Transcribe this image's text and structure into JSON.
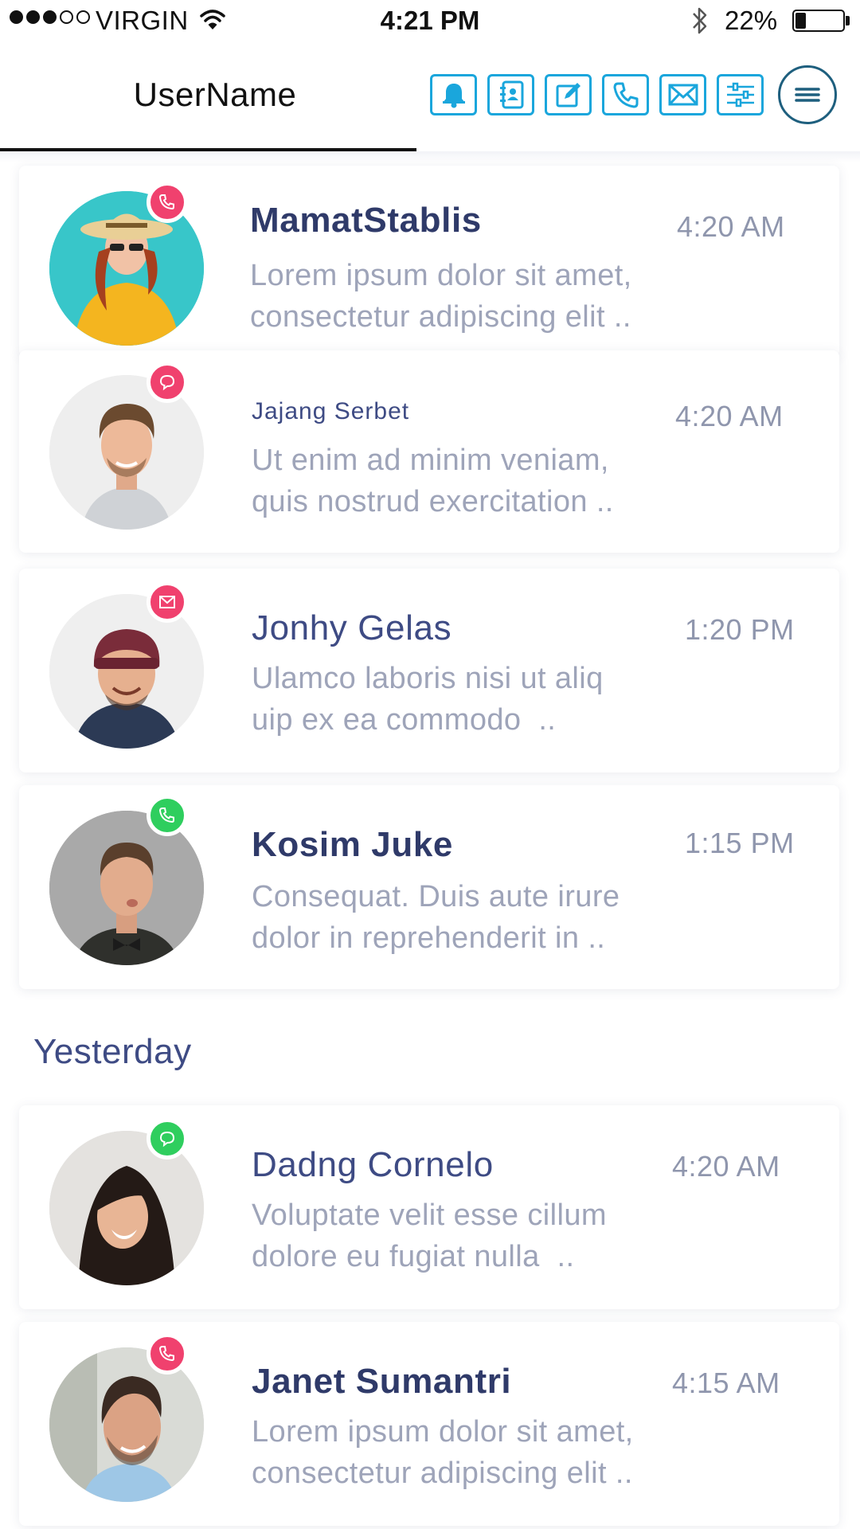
{
  "status_bar": {
    "carrier": "VIRGIN",
    "time": "4:21 PM",
    "battery": "22%",
    "battery_level": 0.22
  },
  "header": {
    "username": "UserName",
    "toolbar": [
      "bell-icon",
      "contacts-icon",
      "compose-icon",
      "phone-icon",
      "mail-icon",
      "settings-sliders-icon"
    ],
    "menu_icon": "hamburger-menu-icon"
  },
  "colors": {
    "accent": "#1aa6dc",
    "menu_ring": "#1e5f7e",
    "name_text": "#2f3a69",
    "preview_text": "#9ea4b9",
    "badge_pink": "#f0416e",
    "badge_green": "#2fce5e"
  },
  "sections": {
    "yesterday": "Yesterday"
  },
  "conversations": [
    {
      "name": "MamatStablis",
      "time": "4:20 AM",
      "preview_line1": "Lorem ipsum dolor sit amet,",
      "preview_line2": "consectetur adipiscing elit ..",
      "badge": "phone-icon",
      "badge_color": "pink"
    },
    {
      "name": "Jajang Serbet",
      "time": "4:20 AM",
      "preview_line1": "Ut enim ad minim veniam,",
      "preview_line2": "quis nostrud exercitation ..",
      "badge": "chat-bubble-icon",
      "badge_color": "pink"
    },
    {
      "name": "Jonhy Gelas",
      "time": "1:20 PM",
      "preview_line1": "Ulamco laboris nisi ut aliq",
      "preview_line2": "uip ex ea commodo  ..",
      "badge": "mail-icon",
      "badge_color": "pink"
    },
    {
      "name": "Kosim Juke",
      "time": "1:15 PM",
      "preview_line1": "Consequat. Duis aute irure",
      "preview_line2": "dolor in reprehenderit in ..",
      "badge": "phone-icon",
      "badge_color": "green"
    },
    {
      "name": "Dadng Cornelo",
      "time": "4:20 AM",
      "preview_line1": "Voluptate velit esse cillum",
      "preview_line2": "dolore eu fugiat nulla  ..",
      "badge": "chat-bubble-icon",
      "badge_color": "green"
    },
    {
      "name": "Janet Sumantri",
      "time": "4:15 AM",
      "preview_line1": "Lorem ipsum dolor sit amet,",
      "preview_line2": "consectetur adipiscing elit ..",
      "badge": "phone-icon",
      "badge_color": "pink"
    }
  ]
}
